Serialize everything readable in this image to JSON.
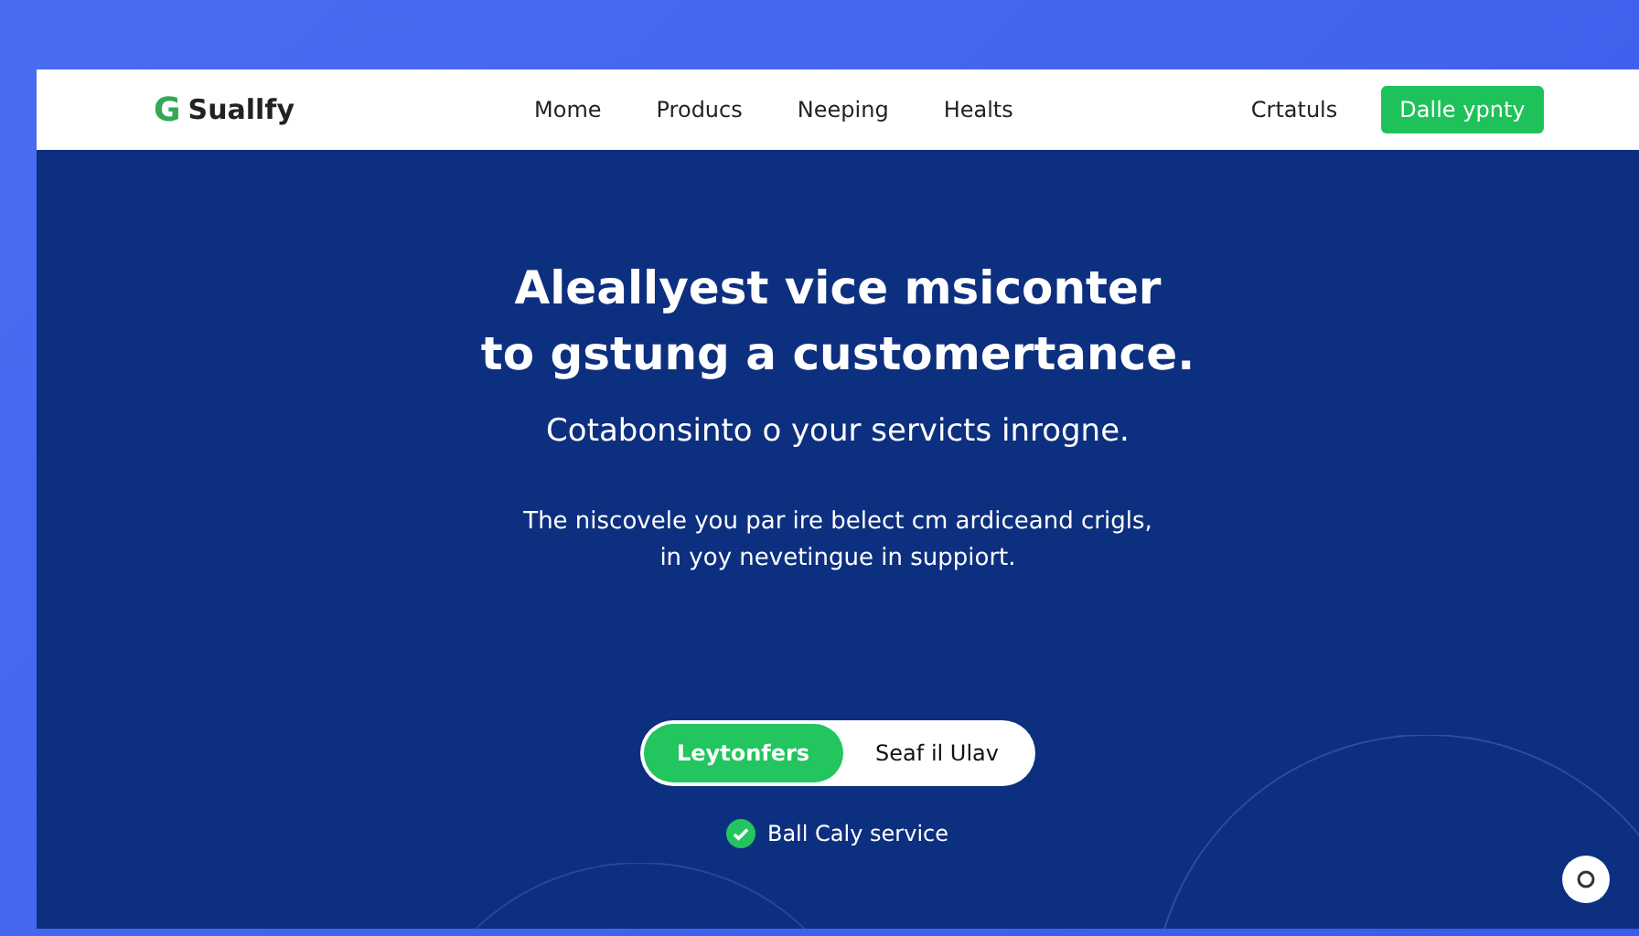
{
  "logo": {
    "mark": "G",
    "name": "Suallfy"
  },
  "nav": {
    "links": [
      "Mome",
      "Producs",
      "Neeping",
      "Healts"
    ],
    "secondary": "Crtatuls",
    "cta": "Dalle ypnty"
  },
  "hero": {
    "title_lines": [
      "Aleallyest vice msiconter",
      "to gstung a customertance."
    ],
    "subtitle": "Cotabonsinto o your servicts inrogne.",
    "body_lines": [
      "The niscovele you par ire belect cm ardiceand crigls,",
      "in yoy nevetingue in suppiort."
    ],
    "toggle": [
      {
        "label": "Leytonfers",
        "selected": true
      },
      {
        "label": "Seaf il Ulav",
        "selected": false
      }
    ],
    "check": {
      "label": "Ball Caly service",
      "checked": true
    }
  }
}
